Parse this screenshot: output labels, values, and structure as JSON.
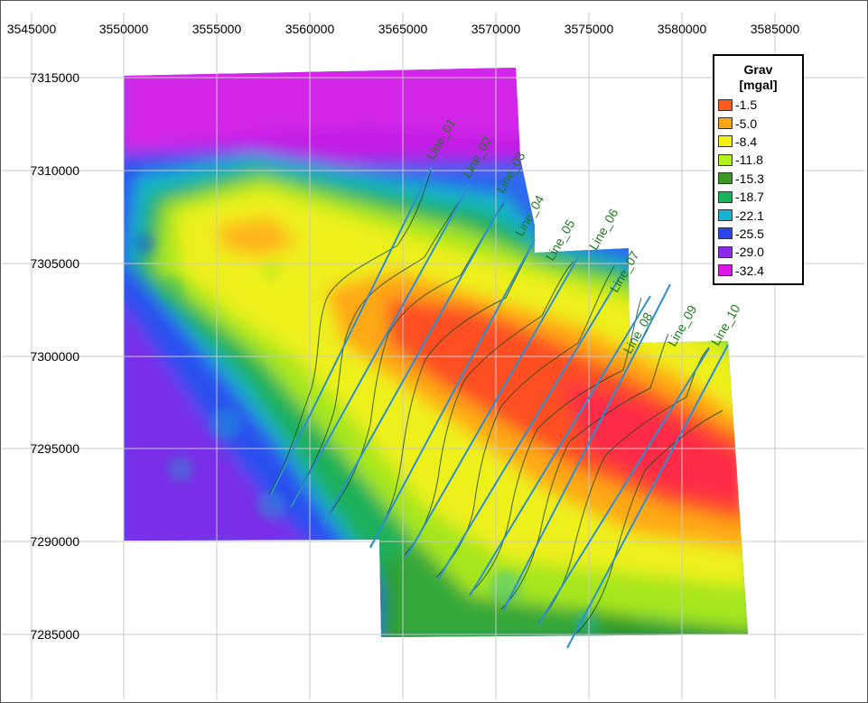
{
  "map": {
    "x_ticks": [
      "3545000",
      "3550000",
      "3555000",
      "3560000",
      "3565000",
      "3570000",
      "3575000",
      "3580000",
      "3585000"
    ],
    "y_ticks": [
      "7315000",
      "7310000",
      "7305000",
      "7300000",
      "7295000",
      "7290000",
      "7285000"
    ],
    "line_labels": [
      "Line_01",
      "Line_02",
      "Line_03",
      "Line_04",
      "Line_05",
      "Line_06",
      "Line_07",
      "Line_08",
      "Line_09",
      "Line_10"
    ],
    "grid_color": "#c8c8c8",
    "profile_line_color": "#2a8fd6",
    "contour_color": "#1e4d1e"
  },
  "legend": {
    "title": "Grav",
    "unit": "[mgal]",
    "items": [
      {
        "value": "-1.5",
        "color": "#ff5a1e"
      },
      {
        "value": "-5.0",
        "color": "#ffa514"
      },
      {
        "value": "-8.4",
        "color": "#f5f014"
      },
      {
        "value": "-11.8",
        "color": "#b4f01e"
      },
      {
        "value": "-15.3",
        "color": "#3c9628"
      },
      {
        "value": "-18.7",
        "color": "#14b45a"
      },
      {
        "value": "-22.1",
        "color": "#14b4d2"
      },
      {
        "value": "-25.5",
        "color": "#2846f0"
      },
      {
        "value": "-29.0",
        "color": "#8c28e6"
      },
      {
        "value": "-32.4",
        "color": "#dc14e6"
      }
    ]
  }
}
